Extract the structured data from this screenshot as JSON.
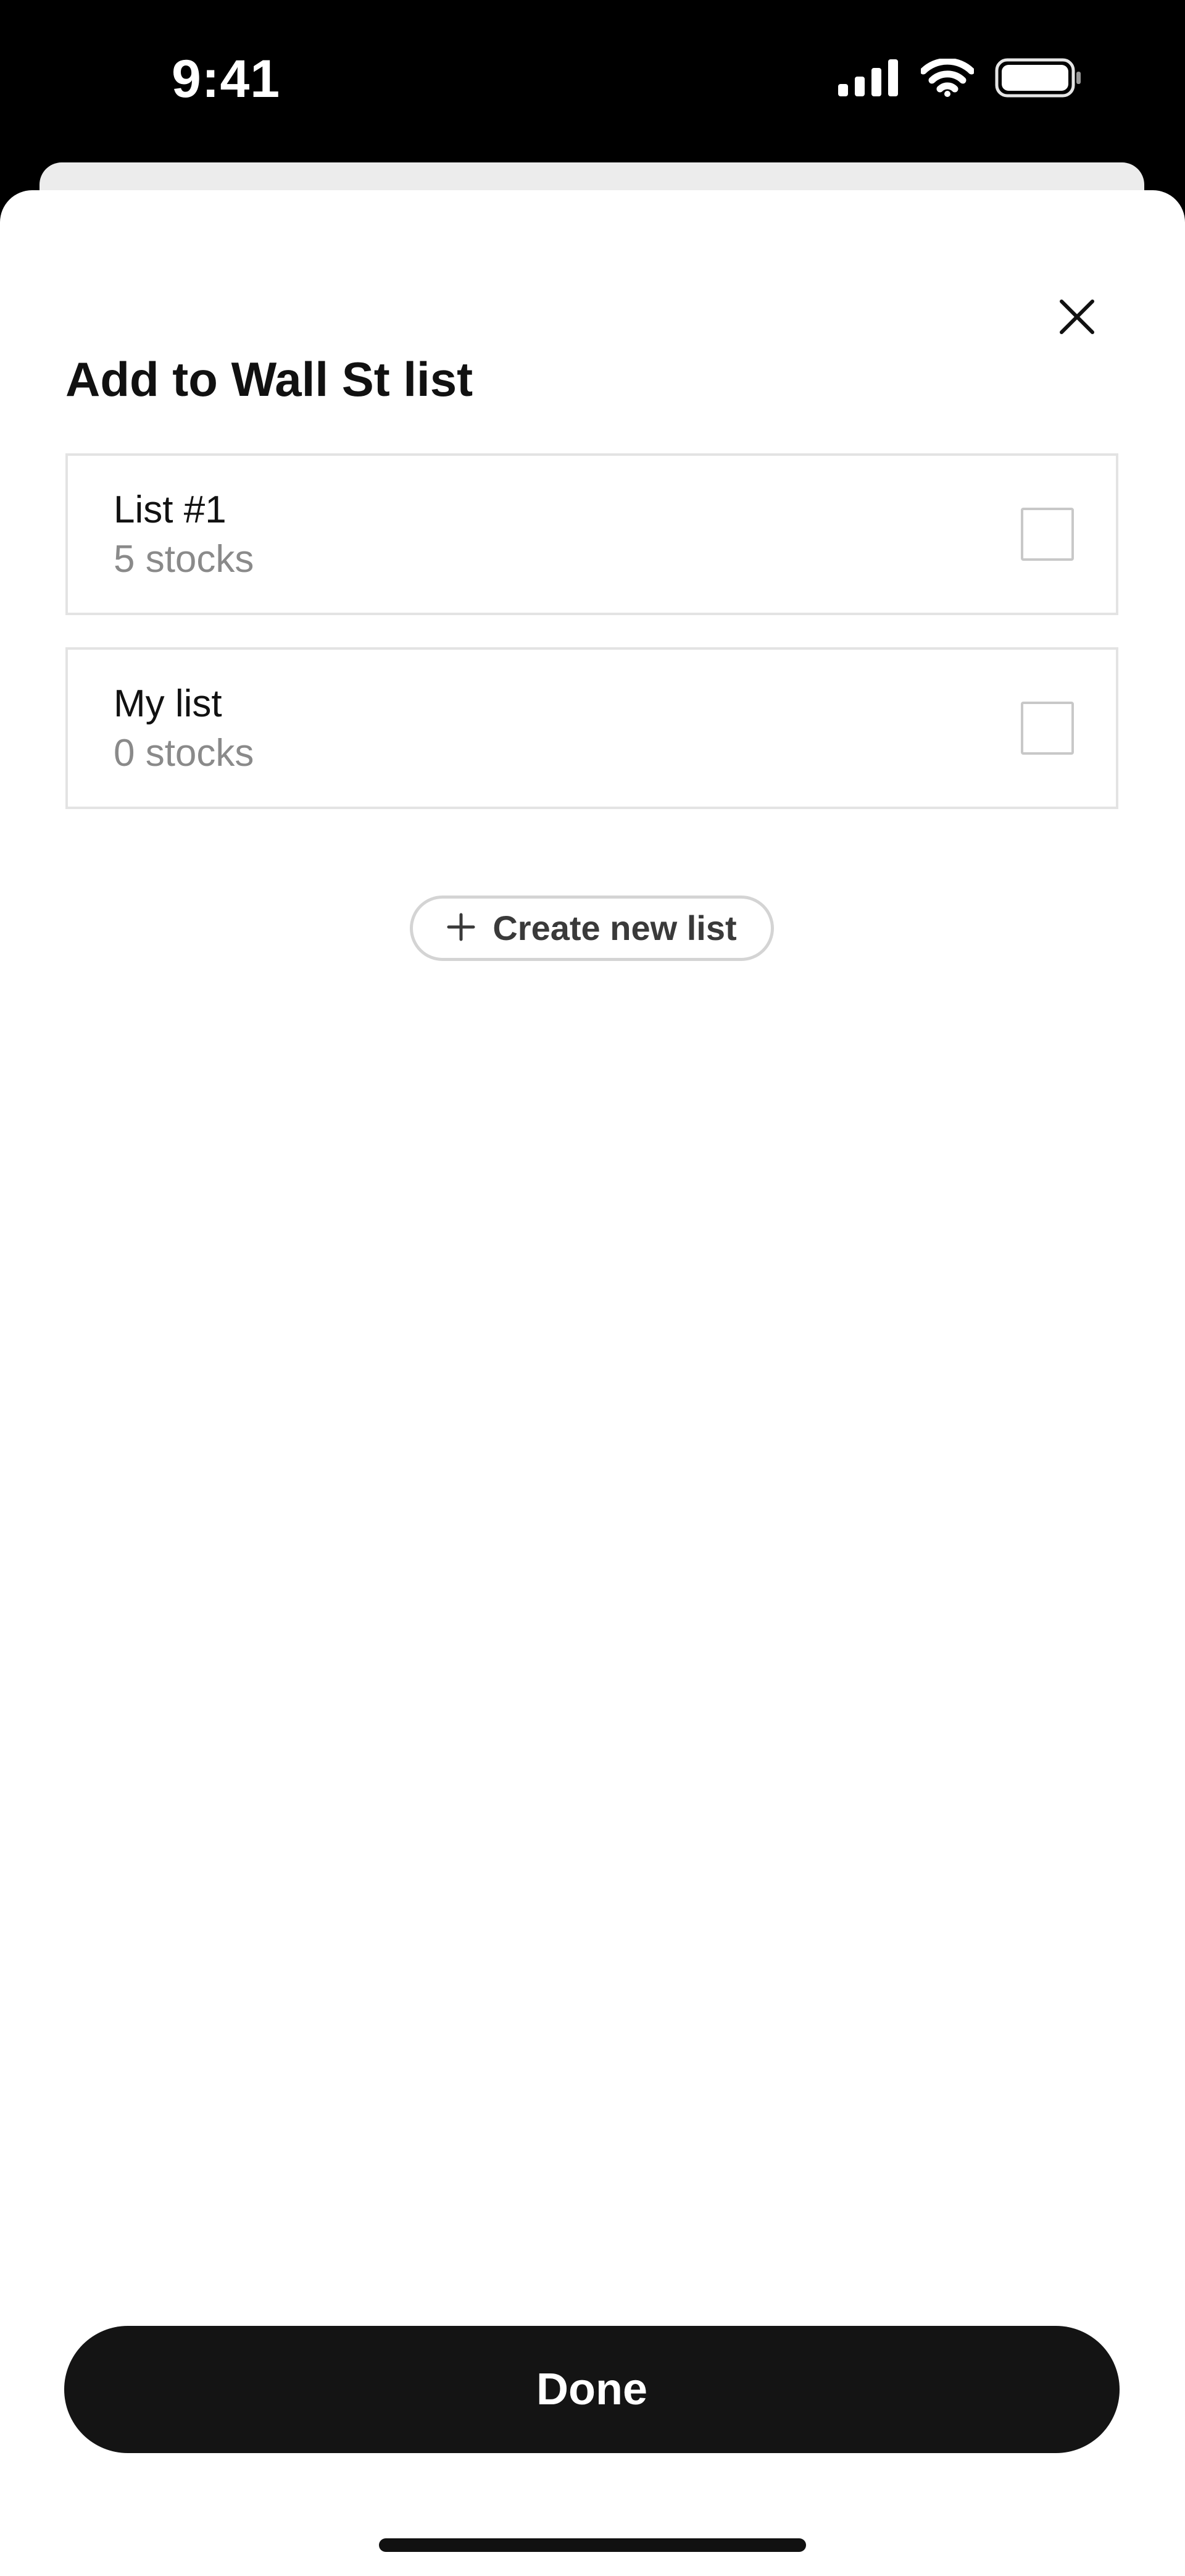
{
  "status_bar": {
    "time": "9:41",
    "icons": [
      "cellular-signal-icon",
      "wifi-icon",
      "battery-icon"
    ]
  },
  "sheet": {
    "title": "Add to Wall St list",
    "close_icon": "close-icon"
  },
  "lists": [
    {
      "name": "List #1",
      "count": "5 stocks",
      "checked": false
    },
    {
      "name": "My list",
      "count": "0 stocks",
      "checked": false
    }
  ],
  "actions": {
    "create_new_list": "Create new list",
    "create_icon": "plus-icon",
    "done": "Done"
  },
  "colors": {
    "primary_button": "#141414",
    "muted_text": "#8a8a8a",
    "border": "#e3e3e3"
  }
}
